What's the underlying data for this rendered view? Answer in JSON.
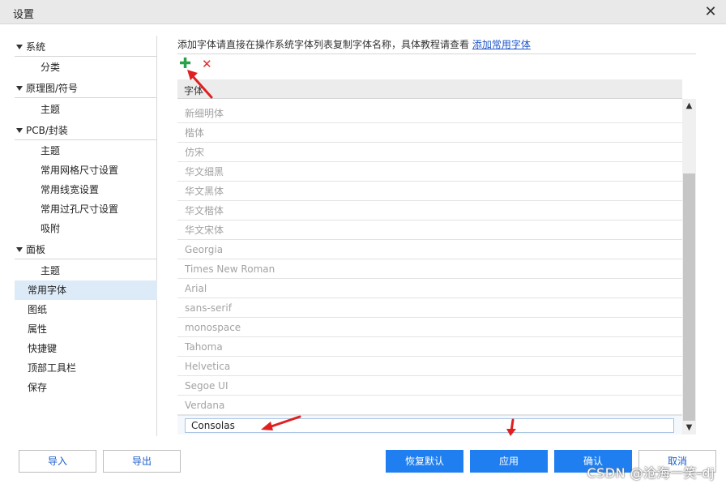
{
  "window": {
    "title": "设置"
  },
  "sidebar": {
    "items": [
      {
        "label": "系统"
      },
      {
        "label": "分类"
      },
      {
        "label": "原理图/符号"
      },
      {
        "label": "主题"
      },
      {
        "label": "PCB/封装"
      },
      {
        "label": "主题"
      },
      {
        "label": "常用网格尺寸设置"
      },
      {
        "label": "常用线宽设置"
      },
      {
        "label": "常用过孔尺寸设置"
      },
      {
        "label": "吸附"
      },
      {
        "label": "面板"
      },
      {
        "label": "主题"
      },
      {
        "label": "常用字体"
      },
      {
        "label": "图纸"
      },
      {
        "label": "属性"
      },
      {
        "label": "快捷键"
      },
      {
        "label": "顶部工具栏"
      },
      {
        "label": "保存"
      }
    ]
  },
  "main": {
    "hint_text": "添加字体请直接在操作系统字体列表复制字体名称，具体教程请查看",
    "hint_link": "添加常用字体",
    "toolbar": {
      "add_icon": "plus-icon",
      "delete_icon": "cross-icon",
      "add_color": "#2aa24a",
      "delete_color": "#e22b2b"
    },
    "table": {
      "header": "字体",
      "rows": [
        "新细明体",
        "楷体",
        "仿宋",
        "华文细黑",
        "华文黑体",
        "华文楷体",
        "华文宋体",
        "Georgia",
        "Times New Roman",
        "Arial",
        "sans-serif",
        "monospace",
        "Tahoma",
        "Helvetica",
        "Segoe UI",
        "Verdana"
      ],
      "editing_value": "Consolas"
    }
  },
  "footer": {
    "import_label": "导入",
    "export_label": "导出",
    "reset_label": "恢复默认",
    "apply_label": "应用",
    "confirm_label": "确认",
    "cancel_label": "取消",
    "accent_color": "#1f7ff0"
  },
  "watermark": "CSDN @沧海一笑-dj"
}
